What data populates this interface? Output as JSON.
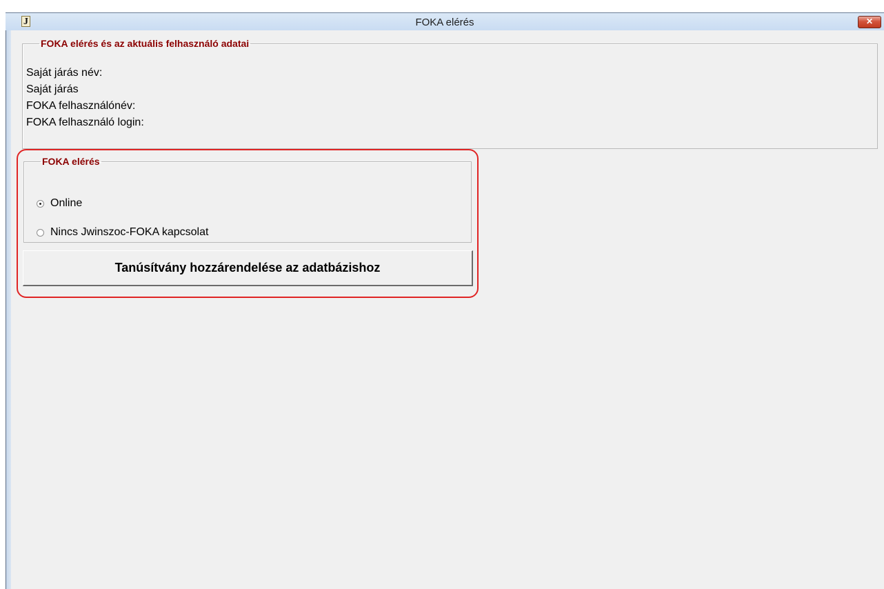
{
  "window": {
    "title": "FOKA elérés",
    "app_icon_letter": "J",
    "close_symbol": "✕"
  },
  "user_group": {
    "legend": "FOKA elérés és az aktuális felhasználó adatai",
    "lines": [
      "Saját járás név:",
      "Saját járás",
      "FOKA felhasználónév:",
      "FOKA felhasználó login:"
    ]
  },
  "access_group": {
    "legend": "FOKA elérés",
    "options": [
      {
        "label": "Online",
        "selected": true
      },
      {
        "label": "Nincs Jwinszoc-FOKA kapcsolat",
        "selected": false
      }
    ]
  },
  "cert_button": {
    "label": "Tanúsítvány hozzárendelése az adatbázishoz"
  },
  "colors": {
    "legend_text": "#8b0000",
    "highlight_border": "#e02424",
    "window_bg": "#f0f0f0"
  }
}
